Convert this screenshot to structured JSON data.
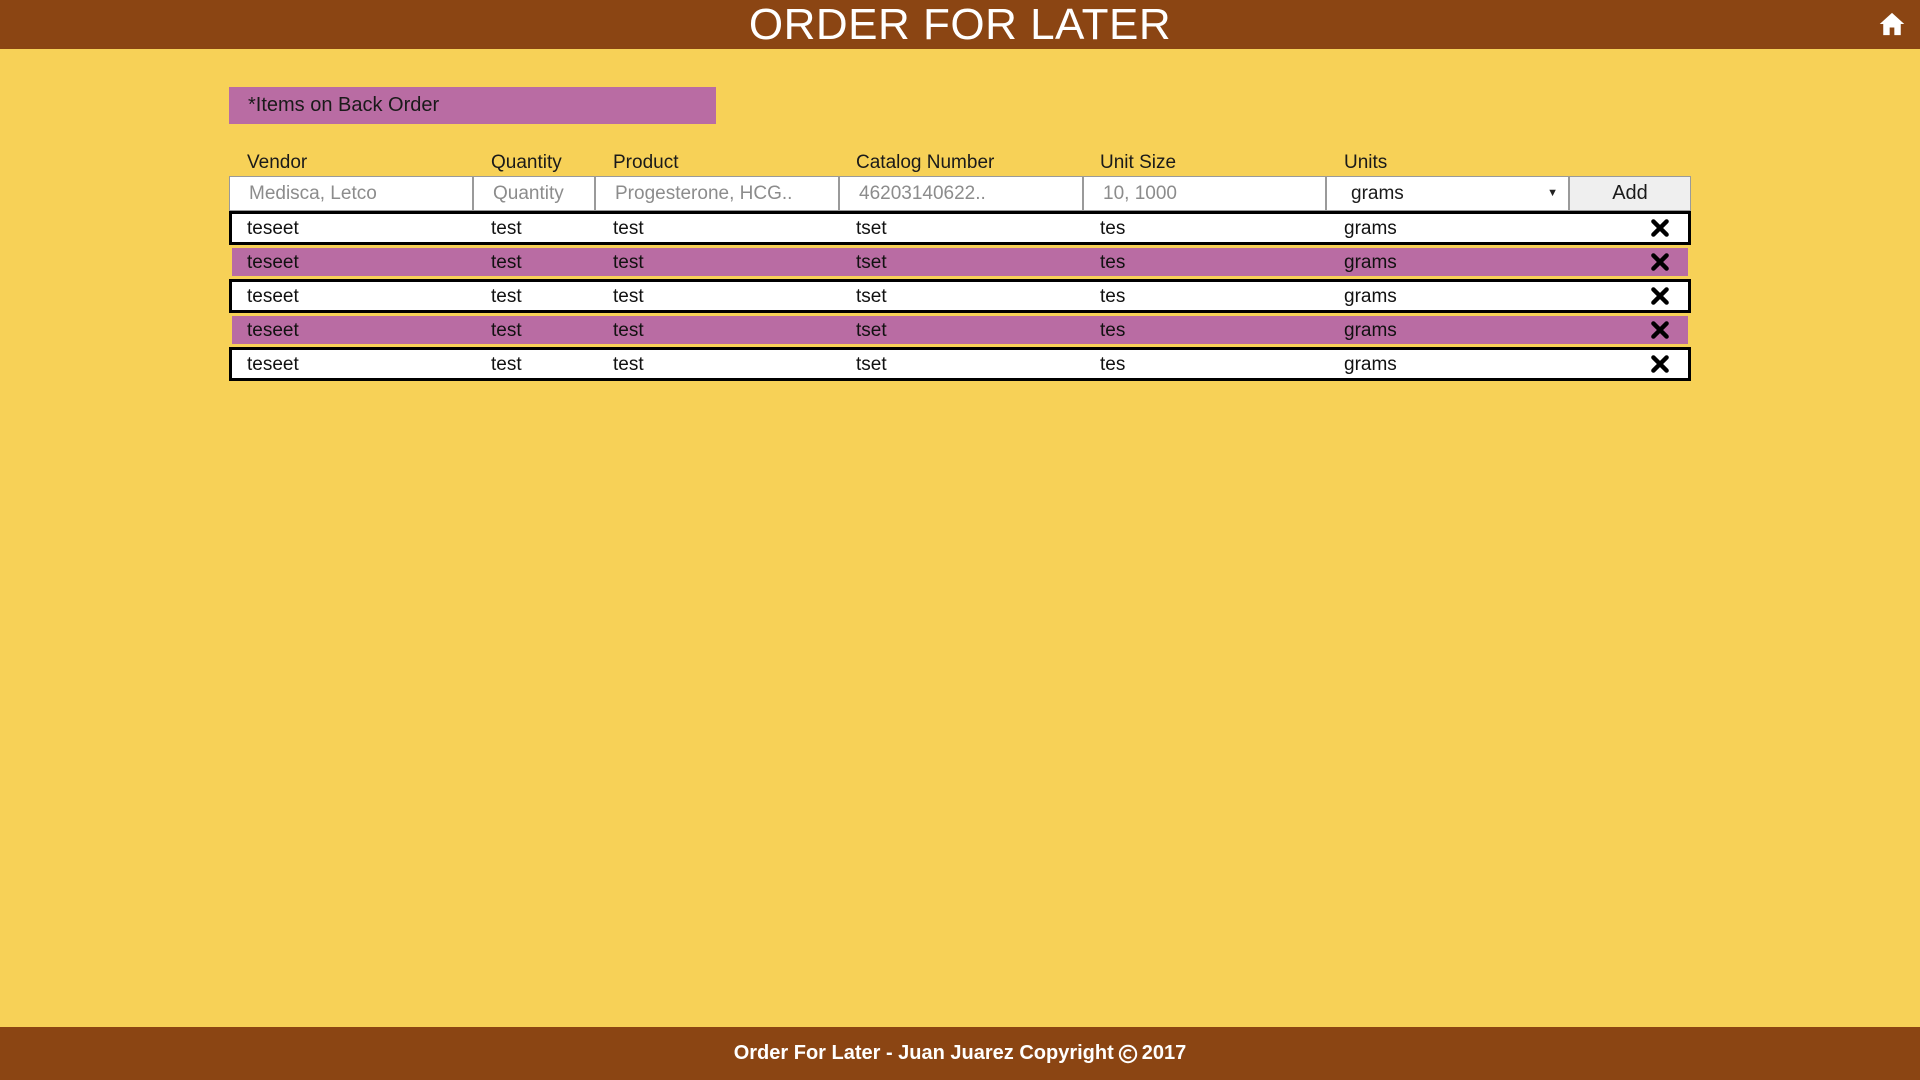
{
  "header": {
    "title": "ORDER FOR LATER",
    "home_icon": "home-icon"
  },
  "backorder_label": "*Items on Back Order",
  "colors": {
    "background": "#f7d157",
    "header": "#8b4513",
    "accent_purple": "#b96ca3"
  },
  "columns": [
    "Vendor",
    "Quantity",
    "Product",
    "Catalog Number",
    "Unit Size",
    "Units"
  ],
  "form": {
    "vendor_placeholder": "Medisca, Letco",
    "quantity_placeholder": "Quantity",
    "product_placeholder": "Progesterone, HCG..",
    "catalog_placeholder": "46203140622..",
    "unit_size_placeholder": "10, 1000",
    "units_selected": "grams",
    "add_label": "Add"
  },
  "rows": [
    {
      "vendor": "teseet",
      "quantity": "test",
      "product": "test",
      "catalog": "tset",
      "unit_size": "tes",
      "units": "grams",
      "backorder": false
    },
    {
      "vendor": "teseet",
      "quantity": "test",
      "product": "test",
      "catalog": "tset",
      "unit_size": "tes",
      "units": "grams",
      "backorder": true
    },
    {
      "vendor": "teseet",
      "quantity": "test",
      "product": "test",
      "catalog": "tset",
      "unit_size": "tes",
      "units": "grams",
      "backorder": false
    },
    {
      "vendor": "teseet",
      "quantity": "test",
      "product": "test",
      "catalog": "tset",
      "unit_size": "tes",
      "units": "grams",
      "backorder": true
    },
    {
      "vendor": "teseet",
      "quantity": "test",
      "product": "test",
      "catalog": "tset",
      "unit_size": "tes",
      "units": "grams",
      "backorder": false
    }
  ],
  "footer": {
    "text_before": "Order For Later - Juan Juarez Copyright",
    "year": "2017"
  }
}
